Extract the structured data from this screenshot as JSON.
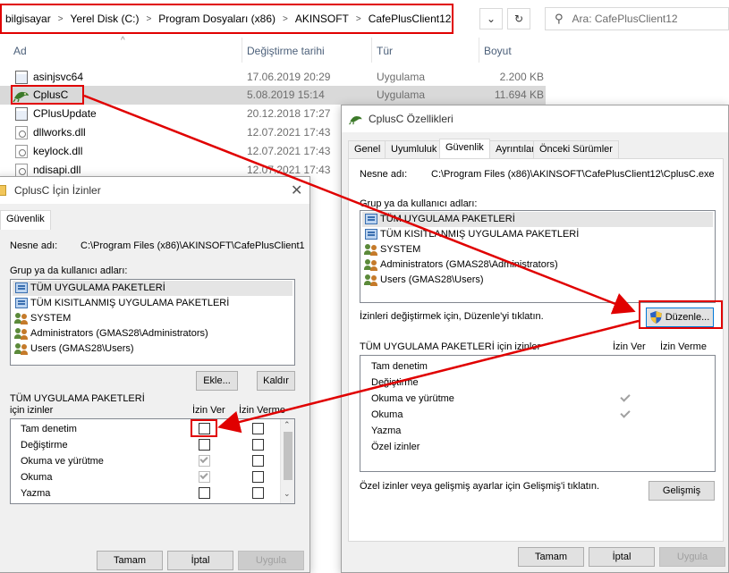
{
  "explorer": {
    "breadcrumb": [
      "bilgisayar",
      "Yerel Disk (C:)",
      "Program Dosyaları (x86)",
      "AKINSOFT",
      "CafePlusClient12"
    ],
    "search_placeholder": "Ara: CafePlusClient12",
    "columns": {
      "name": "Ad",
      "date": "Değiştirme tarihi",
      "type": "Tür",
      "size": "Boyut"
    },
    "files": [
      {
        "name": "asinjsvc64",
        "date": "17.06.2019 20:29",
        "type": "Uygulama",
        "size": "2.200 KB",
        "icon": "exe-icon"
      },
      {
        "name": "CplusC",
        "date": "5.08.2019 15:14",
        "type": "Uygulama",
        "size": "11.694 KB",
        "icon": "cplus-icon",
        "selected": true
      },
      {
        "name": "CPlusUpdate",
        "date": "20.12.2018 17:27",
        "type": "",
        "size": "",
        "icon": "exe-icon"
      },
      {
        "name": "dllworks.dll",
        "date": "12.07.2021 17:43",
        "type": "",
        "size": "",
        "icon": "dll-icon"
      },
      {
        "name": "keylock.dll",
        "date": "12.07.2021 17:43",
        "type": "",
        "size": "",
        "icon": "dll-icon"
      },
      {
        "name": "ndisapi.dll",
        "date": "12.07.2021 17:43",
        "type": "",
        "size": "",
        "icon": "dll-icon"
      }
    ]
  },
  "props": {
    "title": "CplusC Özellikleri",
    "tabs": [
      "Genel",
      "Uyumluluk",
      "Güvenlik",
      "Ayrıntılar",
      "Önceki Sürümler"
    ],
    "object_label": "Nesne adı:",
    "object_value": "C:\\Program Files (x86)\\AKINSOFT\\CafePlusClient12\\CplusC.exe",
    "group_label": "Grup ya da kullanıcı adları:",
    "groups": [
      {
        "name": "TÜM UYGULAMA PAKETLERİ",
        "icon": "group-icon"
      },
      {
        "name": "TÜM KISITLANMIŞ UYGULAMA PAKETLERİ",
        "icon": "group-icon"
      },
      {
        "name": "SYSTEM",
        "icon": "users-icon"
      },
      {
        "name": "Administrators (GMAS28\\Administrators)",
        "icon": "users-icon"
      },
      {
        "name": "Users (GMAS28\\Users)",
        "icon": "users-icon"
      }
    ],
    "edit_hint": "İzinleri değiştirmek için, Düzenle'yi tıklatın.",
    "edit_button": "Düzenle...",
    "perm_header": "TÜM UYGULAMA PAKETLERİ için izinler",
    "allow_header": "İzin Ver",
    "deny_header": "İzin Verme",
    "permissions": [
      {
        "name": "Tam denetim",
        "allow": false
      },
      {
        "name": "Değiştirme",
        "allow": false
      },
      {
        "name": "Okuma ve yürütme",
        "allow": true
      },
      {
        "name": "Okuma",
        "allow": true
      },
      {
        "name": "Yazma",
        "allow": false
      },
      {
        "name": "Özel izinler",
        "allow": false
      }
    ],
    "advanced_hint": "Özel izinler veya gelişmiş ayarlar için Gelişmiş'i tıklatın.",
    "advanced_button": "Gelişmiş",
    "ok": "Tamam",
    "cancel": "İptal",
    "apply": "Uygula"
  },
  "perm": {
    "title": "CplusC İçin İzinler",
    "tab": "Güvenlik",
    "object_label": "Nesne adı:",
    "object_value": "C:\\Program Files (x86)\\AKINSOFT\\CafePlusClient1",
    "group_label": "Grup ya da kullanıcı adları:",
    "groups": [
      {
        "name": "TÜM UYGULAMA PAKETLERİ",
        "icon": "group-icon"
      },
      {
        "name": "TÜM KISITLANMIŞ UYGULAMA PAKETLERİ",
        "icon": "group-icon"
      },
      {
        "name": "SYSTEM",
        "icon": "users-icon"
      },
      {
        "name": "Administrators (GMAS28\\Administrators)",
        "icon": "users-icon"
      },
      {
        "name": "Users (GMAS28\\Users)",
        "icon": "users-icon"
      }
    ],
    "add_button": "Ekle...",
    "remove_button": "Kaldır",
    "perm_header_line1": "TÜM UYGULAMA PAKETLERİ",
    "perm_header_line2": "için izinler",
    "allow_header": "İzin Ver",
    "deny_header": "İzin Verme",
    "permissions": [
      {
        "name": "Tam denetim",
        "allow": false,
        "allow_disabled": false
      },
      {
        "name": "Değiştirme",
        "allow": false,
        "allow_disabled": false
      },
      {
        "name": "Okuma ve yürütme",
        "allow": true,
        "allow_disabled": true
      },
      {
        "name": "Okuma",
        "allow": true,
        "allow_disabled": true
      },
      {
        "name": "Yazma",
        "allow": false,
        "allow_disabled": false
      }
    ],
    "ok": "Tamam",
    "cancel": "İptal",
    "apply": "Uygula"
  },
  "colors": {
    "annotation": "#e00000",
    "selection": "#d9d9d9",
    "dialog_bg": "#f0f0f0"
  }
}
